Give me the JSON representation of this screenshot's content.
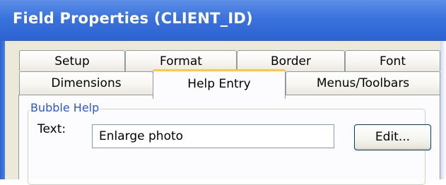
{
  "window": {
    "title": "Field Properties (CLIENT_ID)"
  },
  "tabs": {
    "row1": [
      "Setup",
      "Format",
      "Border",
      "Font"
    ],
    "row2": [
      "Dimensions",
      "Help Entry",
      "Menus/Toolbars"
    ],
    "active": "Help Entry"
  },
  "bubble_help": {
    "group_label": "Bubble Help",
    "text_label": "Text:",
    "text_value": "Enlarge photo",
    "edit_button_label": "Edit..."
  },
  "colors": {
    "titlebar": "#3a72dc",
    "active_tab_highlight": "#ffc83c",
    "group_label": "#2a58d6",
    "dialog_background": "#ece9d8"
  }
}
